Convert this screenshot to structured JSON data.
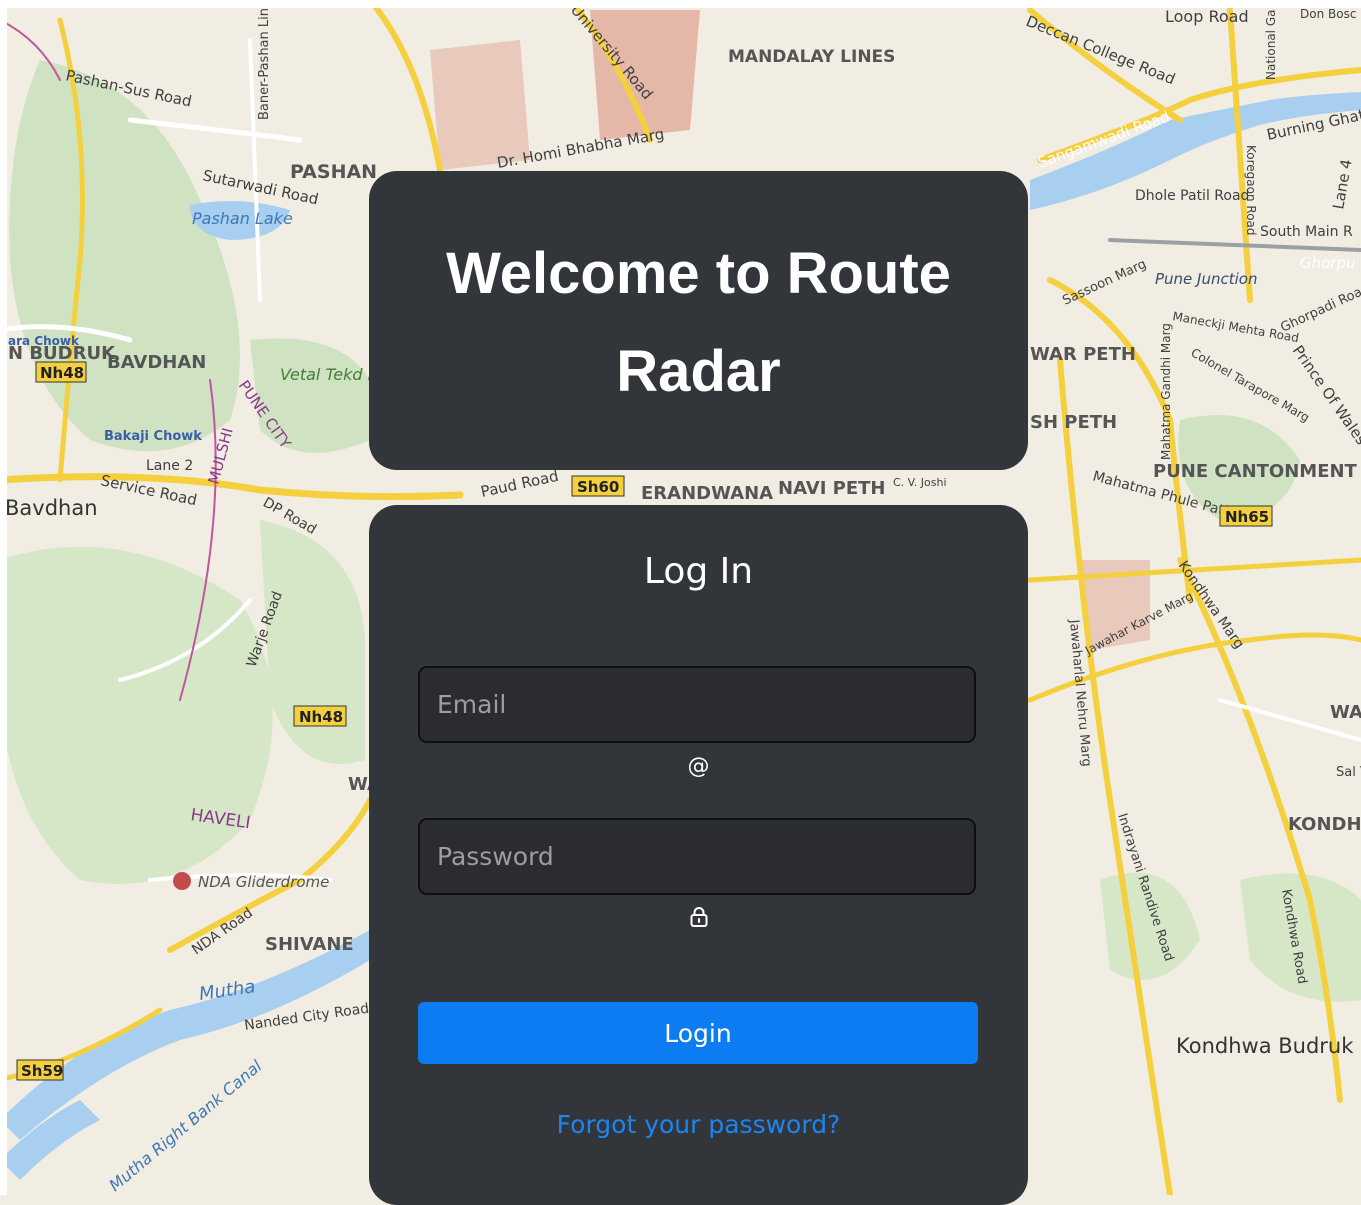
{
  "colors": {
    "card_bg": "#32353a",
    "login_button": "#0d7cf2",
    "link": "#1c86f0",
    "map_land": "#f1ede3",
    "map_green": "#cfe3c2",
    "map_water": "#a8cfef",
    "map_road_major": "#f4d03f"
  },
  "welcome": {
    "title": "Welcome to Route Radar"
  },
  "login": {
    "heading": "Log In",
    "email_placeholder": "Email",
    "email_icon": "@",
    "password_placeholder": "Password",
    "password_icon": "lock-icon",
    "button_label": "Login",
    "forgot_link": "Forgot your password?"
  },
  "map": {
    "labels": {
      "pashan_sus_road": "Pashan-Sus Road",
      "baner_pashan": "Baner-Pashan Link Road",
      "mandalay_lines": "MANDALAY LINES",
      "loop_road": "Loop Road",
      "don_bosco": "Don Bosc Road",
      "deccan": "Deccan College Road",
      "university_road": "University Road",
      "national_ga": "National Ga",
      "burning_ghat": "Burning Ghat Road",
      "homi_bhabha": "Dr. Homi Bhabha Marg",
      "sangamwadi": "Sangamwadi Road",
      "sutarwadi": "Sutarwadi Road",
      "pashan": "PASHAN",
      "pashan_lake": "Pashan Lake",
      "dhole_patil": "Dhole Patil Road",
      "koregaon": "Koregaon Road",
      "lane4": "Lane 4",
      "south_main": "South Main R",
      "pune_junction": "Pune Junction",
      "ghorpu": "Ghorpu",
      "sassoon": "Sassoon Marg",
      "ghorpadi": "Ghorpadi Road",
      "tara_chowk": "ara Chowk",
      "budruk": "N BUDRUK",
      "bavdhan": "BAVDHAN",
      "nh48_a": "Nh48",
      "vetal_tekdi": "Vetal Tekd Forest Area",
      "pune_city": "PUNE CITY",
      "waar_peth": "WAR PETH",
      "maneckji": "Maneckji Mehta Road",
      "colonel": "Colonel Tarapore Marg",
      "prince_wales": "Prince Of Wales",
      "bakaji": "Bakaji Chowk",
      "mulshi": "MULSHI",
      "sh_peth": "SH PETH",
      "mahatma_gandhi": "Mahatma Gandhi Marg",
      "lane2": "Lane 2",
      "service_road": "Service Road",
      "bavdhan_town": "Bavdhan",
      "dp_road": "DP Road",
      "paud_road": "Paud Road",
      "sh60": "Sh60",
      "erandwana": "ERANDWANA",
      "navi_peth": "NAVI PETH",
      "cv_joshi": "C. V. Joshi",
      "pune_cantonment": "PUNE CANTONMENT",
      "phule_path": "Mahatma Phule Path",
      "nh65": "Nh65",
      "kondhwa_marg": "Kondhwa Marg",
      "warje": "Warje Road",
      "karve": "Jawahar Karve Marg",
      "nh48_b": "Nh48",
      "wa": "WA",
      "nehru": "Jawaharlal Nehru Marg",
      "haveli": "HAVELI",
      "sal": "Sal Viha",
      "kondh": "KONDH",
      "nda_glider": "NDA Gliderdrome",
      "nda_road": "NDA Road",
      "shivane": "SHIVANE",
      "indrayani": "Indrayani Randive Road",
      "kondhwa_road": "Kondhwa Road",
      "mutha": "Mutha",
      "nanded": "Nanded City Road",
      "sh59": "Sh59",
      "kondhwa_budruk": "Kondhwa Budruk",
      "canal": "Mutha Right Bank Canal"
    }
  }
}
